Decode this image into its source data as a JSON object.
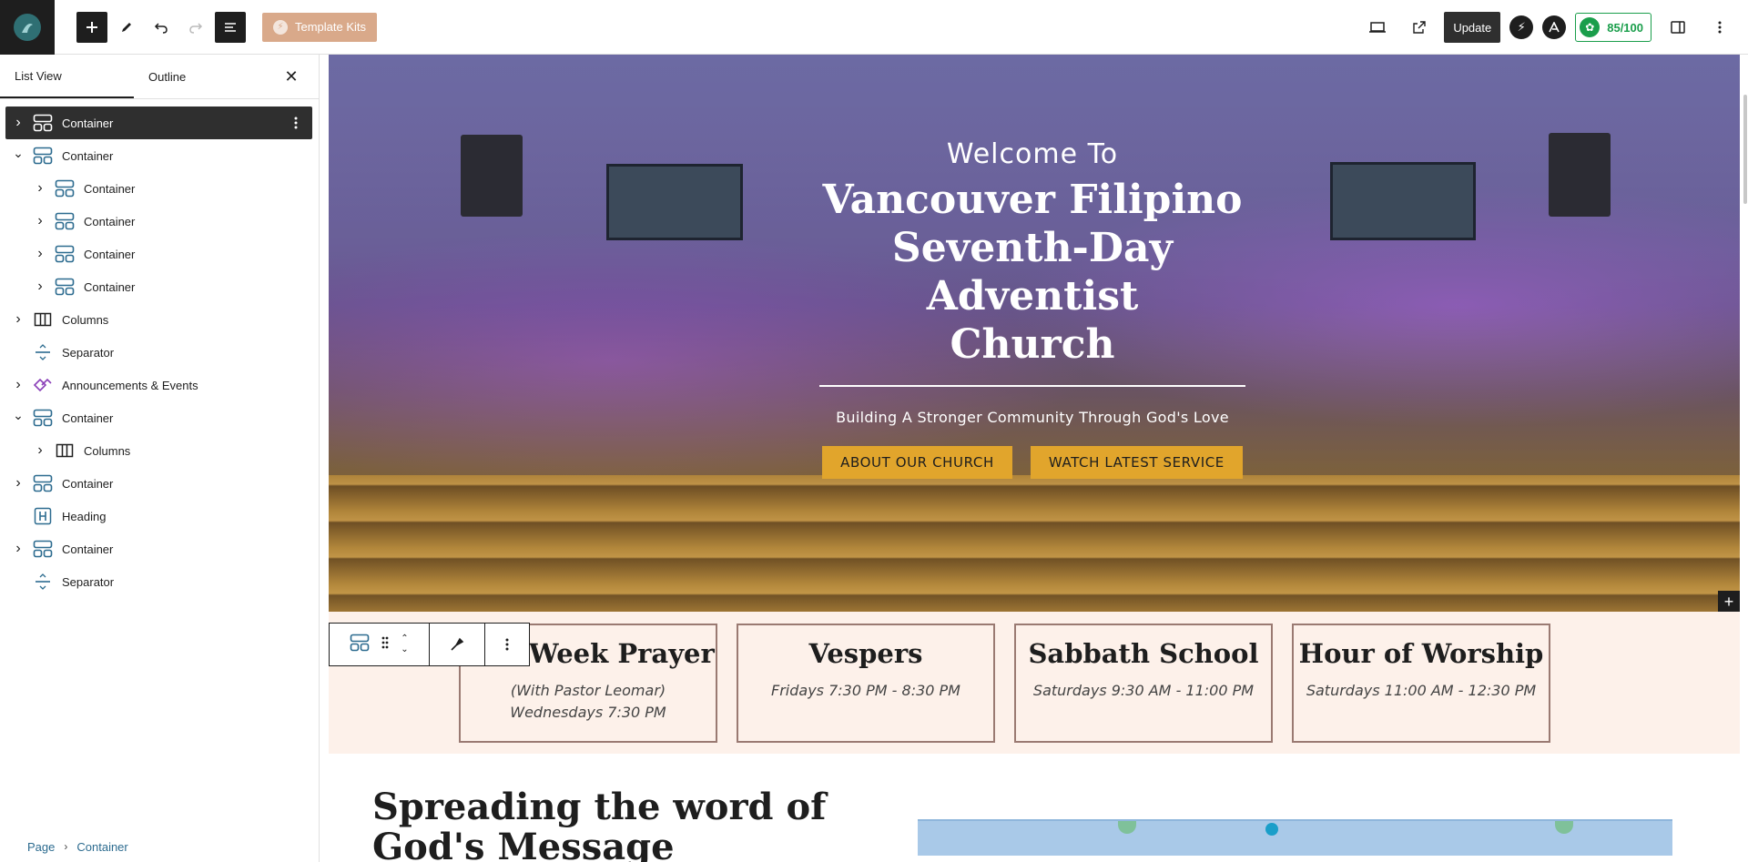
{
  "toolbar": {
    "template_kits_label": "Template Kits",
    "update_label": "Update",
    "score_label": "85/100"
  },
  "left_panel": {
    "tabs": [
      {
        "label": "List View",
        "active": true
      },
      {
        "label": "Outline",
        "active": false
      }
    ],
    "tree": [
      {
        "label": "Container",
        "icon": "container-icon",
        "depth": 0,
        "chevron": "right",
        "selected": true
      },
      {
        "label": "Container",
        "icon": "container-icon",
        "depth": 0,
        "chevron": "down"
      },
      {
        "label": "Container",
        "icon": "container-icon",
        "depth": 1,
        "chevron": "right"
      },
      {
        "label": "Container",
        "icon": "container-icon",
        "depth": 1,
        "chevron": "right"
      },
      {
        "label": "Container",
        "icon": "container-icon",
        "depth": 1,
        "chevron": "right"
      },
      {
        "label": "Container",
        "icon": "container-icon",
        "depth": 1,
        "chevron": "right"
      },
      {
        "label": "Columns",
        "icon": "columns-icon",
        "depth": 0,
        "chevron": "right"
      },
      {
        "label": "Separator",
        "icon": "separator-icon",
        "depth": 0,
        "chevron": "none"
      },
      {
        "label": "Announcements & Events",
        "icon": "pattern-icon",
        "depth": 0,
        "chevron": "right"
      },
      {
        "label": "Container",
        "icon": "container-icon",
        "depth": 0,
        "chevron": "down"
      },
      {
        "label": "Columns",
        "icon": "columns-icon",
        "depth": 1,
        "chevron": "right"
      },
      {
        "label": "Container",
        "icon": "container-icon",
        "depth": 0,
        "chevron": "right"
      },
      {
        "label": "Heading",
        "icon": "heading-icon",
        "depth": 0,
        "chevron": "none"
      },
      {
        "label": "Container",
        "icon": "container-icon",
        "depth": 0,
        "chevron": "right"
      },
      {
        "label": "Separator",
        "icon": "separator-icon",
        "depth": 0,
        "chevron": "none"
      }
    ],
    "breadcrumb": [
      "Page",
      "Container"
    ]
  },
  "hero": {
    "welcome": "Welcome To",
    "church_name_lines": [
      "Vancouver Filipino",
      "Seventh-Day Adventist",
      "Church"
    ],
    "tagline": "Building A Stronger Community Through God's Love",
    "buttons": [
      "ABOUT OUR CHURCH",
      "WATCH LATEST SERVICE"
    ]
  },
  "services": [
    {
      "title": "Mid-Week Prayer",
      "lines": [
        "(With Pastor Leomar)",
        "Wednesdays 7:30 PM"
      ]
    },
    {
      "title": "Vespers",
      "lines": [
        "Fridays 7:30 PM - 8:30 PM"
      ]
    },
    {
      "title": "Sabbath School",
      "lines": [
        "Saturdays 9:30 AM - 11:00 PM"
      ]
    },
    {
      "title": "Hour of Worship",
      "lines": [
        "Saturdays 11:00 AM - 12:30 PM"
      ]
    }
  ],
  "section_heading": "Spreading the word of God's Message",
  "colors": {
    "accent_button": "#e1a52c",
    "services_bg": "#fdf1ea",
    "score_green": "#1a9e4b",
    "template_kits": "#d9a98a"
  }
}
